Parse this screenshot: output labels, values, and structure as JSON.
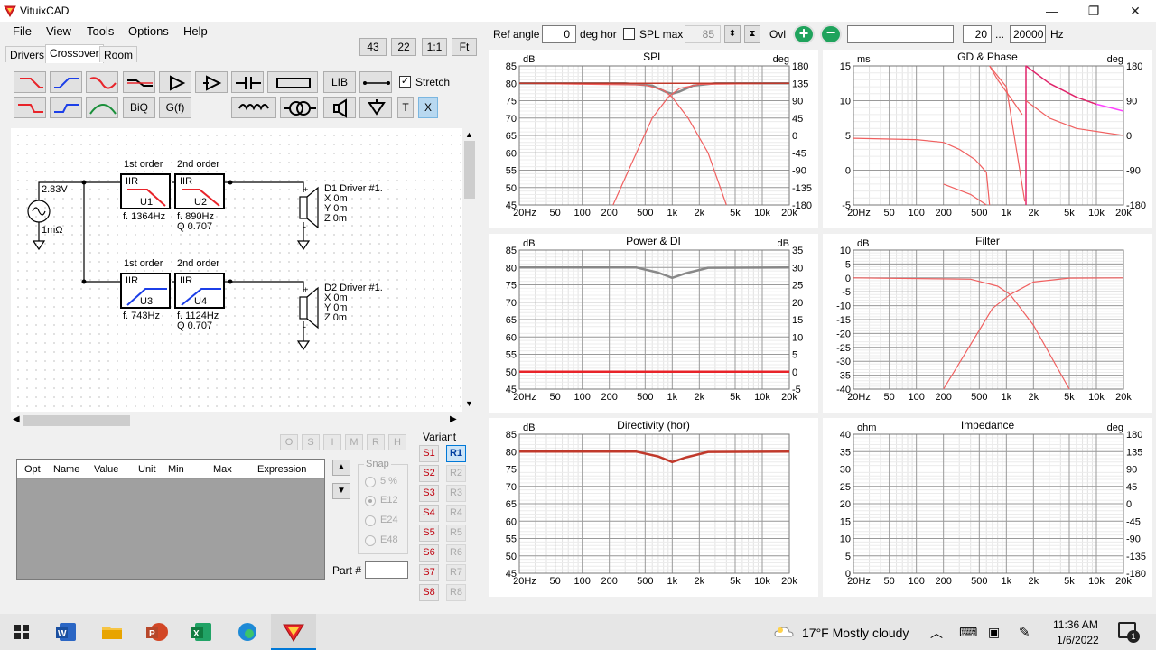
{
  "app": {
    "title": "VituixCAD"
  },
  "window_controls": {
    "minimize": "—",
    "restore": "❐",
    "close": "✕"
  },
  "menu": [
    "File",
    "View",
    "Tools",
    "Options",
    "Help"
  ],
  "tabs": [
    "Drivers",
    "Crossover",
    "Room"
  ],
  "zoom_buttons": [
    "43",
    "22",
    "1:1",
    "Ft"
  ],
  "toolbar": {
    "stretch_label": "Stretch",
    "lib": "LIB",
    "biq": "BiQ",
    "gf": "G(f)",
    "t": "T",
    "x": "X"
  },
  "schematic": {
    "source_voltage": "2.83V",
    "source_impedance": "1mΩ",
    "blocks": [
      {
        "header": "1st order",
        "type": "IIR",
        "name": "U1",
        "f": "f. 1364Hz",
        "q": ""
      },
      {
        "header": "2nd order",
        "type": "IIR",
        "name": "U2",
        "f": "f. 890Hz",
        "q": "Q 0.707"
      },
      {
        "header": "1st order",
        "type": "IIR",
        "name": "U3",
        "f": "f. 743Hz",
        "q": ""
      },
      {
        "header": "2nd order",
        "type": "IIR",
        "name": "U4",
        "f": "f. 1124Hz",
        "q": "Q 0.707"
      }
    ],
    "drivers": [
      {
        "name": "D1 Driver #1.",
        "x": "X 0m",
        "y": "Y 0m",
        "z": "Z 0m"
      },
      {
        "name": "D2 Driver #1.",
        "x": "X 0m",
        "y": "Y 0m",
        "z": "Z 0m"
      }
    ]
  },
  "osi_buttons": [
    "O",
    "S",
    "I",
    "M",
    "R",
    "H"
  ],
  "param_table": {
    "columns": [
      "Opt",
      "Name",
      "Value",
      "Unit",
      "Min",
      "Max",
      "Expression"
    ]
  },
  "snap": {
    "label": "Snap",
    "options": [
      "5 %",
      "E12",
      "E24",
      "E48"
    ],
    "selected": "E12"
  },
  "part_label": "Part #",
  "variant": {
    "label": "Variant",
    "s": [
      "S1",
      "S2",
      "S3",
      "S4",
      "S5",
      "S6",
      "S7",
      "S8"
    ],
    "r": [
      "R1",
      "R2",
      "R3",
      "R4",
      "R5",
      "R6",
      "R7",
      "R8"
    ],
    "active": "R1"
  },
  "topbar": {
    "ref_angle_label": "Ref angle",
    "ref_angle_value": "0",
    "deg_hor": "deg hor",
    "spl_max_label": "SPL max",
    "spl_max_value": "85",
    "ovl": "Ovl",
    "freq_min": "20",
    "dots": "...",
    "freq_max": "20000",
    "hz": "Hz"
  },
  "freq_ticks": [
    "20Hz",
    "50",
    "100",
    "200",
    "500",
    "1k",
    "2k",
    "5k",
    "10k",
    "20k"
  ],
  "graphs": [
    {
      "title": "SPL",
      "left_unit": "dB",
      "right_unit": "deg",
      "left_ticks": [
        "85",
        "80",
        "75",
        "70",
        "65",
        "60",
        "55",
        "50",
        "45"
      ],
      "right_ticks": [
        "180",
        "135",
        "90",
        "45",
        "0",
        "-45",
        "-90",
        "-135",
        "-180"
      ]
    },
    {
      "title": "GD & Phase",
      "left_unit": "ms",
      "right_unit": "deg",
      "left_ticks": [
        "15",
        "10",
        "5",
        "0",
        "-5"
      ],
      "right_ticks": [
        "180",
        "90",
        "0",
        "-90",
        "-180"
      ]
    },
    {
      "title": "Power & DI",
      "left_unit": "dB",
      "right_unit": "dB",
      "left_ticks": [
        "85",
        "80",
        "75",
        "70",
        "65",
        "60",
        "55",
        "50",
        "45"
      ],
      "right_ticks": [
        "35",
        "30",
        "25",
        "20",
        "15",
        "10",
        "5",
        "0",
        "-5"
      ]
    },
    {
      "title": "Filter",
      "left_unit": "dB",
      "right_unit": "",
      "left_ticks": [
        "10",
        "5",
        "0",
        "-5",
        "-10",
        "-15",
        "-20",
        "-25",
        "-30",
        "-35",
        "-40"
      ],
      "right_ticks": []
    },
    {
      "title": "Directivity (hor)",
      "left_unit": "dB",
      "right_unit": "",
      "left_ticks": [
        "85",
        "80",
        "75",
        "70",
        "65",
        "60",
        "55",
        "50",
        "45"
      ],
      "right_ticks": []
    },
    {
      "title": "Impedance",
      "left_unit": "ohm",
      "right_unit": "deg",
      "left_ticks": [
        "40",
        "35",
        "30",
        "25",
        "20",
        "15",
        "10",
        "5",
        "0"
      ],
      "right_ticks": [
        "180",
        "135",
        "90",
        "45",
        "0",
        "-45",
        "-90",
        "-135",
        "-180"
      ]
    }
  ],
  "taskbar": {
    "weather": "17°F  Mostly cloudy",
    "time": "11:36 AM",
    "date": "1/6/2022",
    "notif_count": "1"
  },
  "colors": {
    "red": "#e8242a",
    "blue": "#1c3fe8",
    "green": "#1a8f3a",
    "curve": "#f06060",
    "sum": "#c0392b",
    "magenta": "#ff40ff"
  }
}
